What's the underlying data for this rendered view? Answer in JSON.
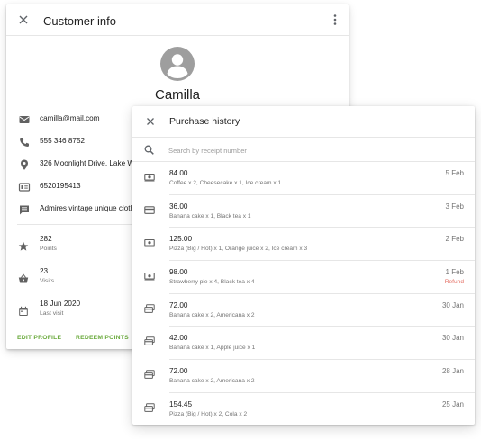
{
  "customer": {
    "title": "Customer info",
    "name": "Camilla",
    "contact": [
      {
        "icon": "email-icon",
        "text": "camilla@mail.com"
      },
      {
        "icon": "phone-icon",
        "text": "555 346 8752"
      },
      {
        "icon": "location-icon",
        "text": "326  Moonlight Drive, Lake W"
      },
      {
        "icon": "id-card-icon",
        "text": "6520195413"
      },
      {
        "icon": "note-icon",
        "text": "Admires vintage unique cloth"
      }
    ],
    "stats": [
      {
        "icon": "star-icon",
        "value": "282",
        "label": "Points"
      },
      {
        "icon": "basket-icon",
        "value": "23",
        "label": "Visits"
      },
      {
        "icon": "calendar-icon",
        "value": "18 Jun 2020",
        "label": "Last visit"
      }
    ],
    "actions": {
      "edit": "EDIT PROFILE",
      "redeem": "REDEEM POINTS"
    },
    "accent_color": "#6aaa3c"
  },
  "purchase_history": {
    "title": "Purchase history",
    "search_placeholder": "Search by receipt number",
    "rows": [
      {
        "icon": "cash-icon",
        "amount": "84.00",
        "items": "Coffee x 2, Cheesecake x 1, Ice cream x 1",
        "date": "5 Feb",
        "status": ""
      },
      {
        "icon": "card-icon",
        "amount": "36.00",
        "items": "Banana cake x 1, Black tea x 1",
        "date": "3 Feb",
        "status": ""
      },
      {
        "icon": "cash-icon",
        "amount": "125.00",
        "items": "Pizza (Big / Hot) x 1, Orange juice x 2, Ice cream x 3",
        "date": "2 Feb",
        "status": ""
      },
      {
        "icon": "cash-icon",
        "amount": "98.00",
        "items": "Strawberry pie x 4, Black tea x 4",
        "date": "1 Feb",
        "status": "Refund"
      },
      {
        "icon": "split-payment-icon",
        "amount": "72.00",
        "items": "Banana cake x 2, Americana x 2",
        "date": "30 Jan",
        "status": ""
      },
      {
        "icon": "split-payment-icon",
        "amount": "42.00",
        "items": "Banana cake x 1, Apple juice x 1",
        "date": "30 Jan",
        "status": ""
      },
      {
        "icon": "split-payment-icon",
        "amount": "72.00",
        "items": "Banana cake x 2, Americana x 2",
        "date": "28 Jan",
        "status": ""
      },
      {
        "icon": "split-payment-icon",
        "amount": "154.45",
        "items": "Pizza (Big / Hot) x 2, Cola x 2",
        "date": "25 Jan",
        "status": ""
      }
    ],
    "refund_color": "#e57368"
  }
}
